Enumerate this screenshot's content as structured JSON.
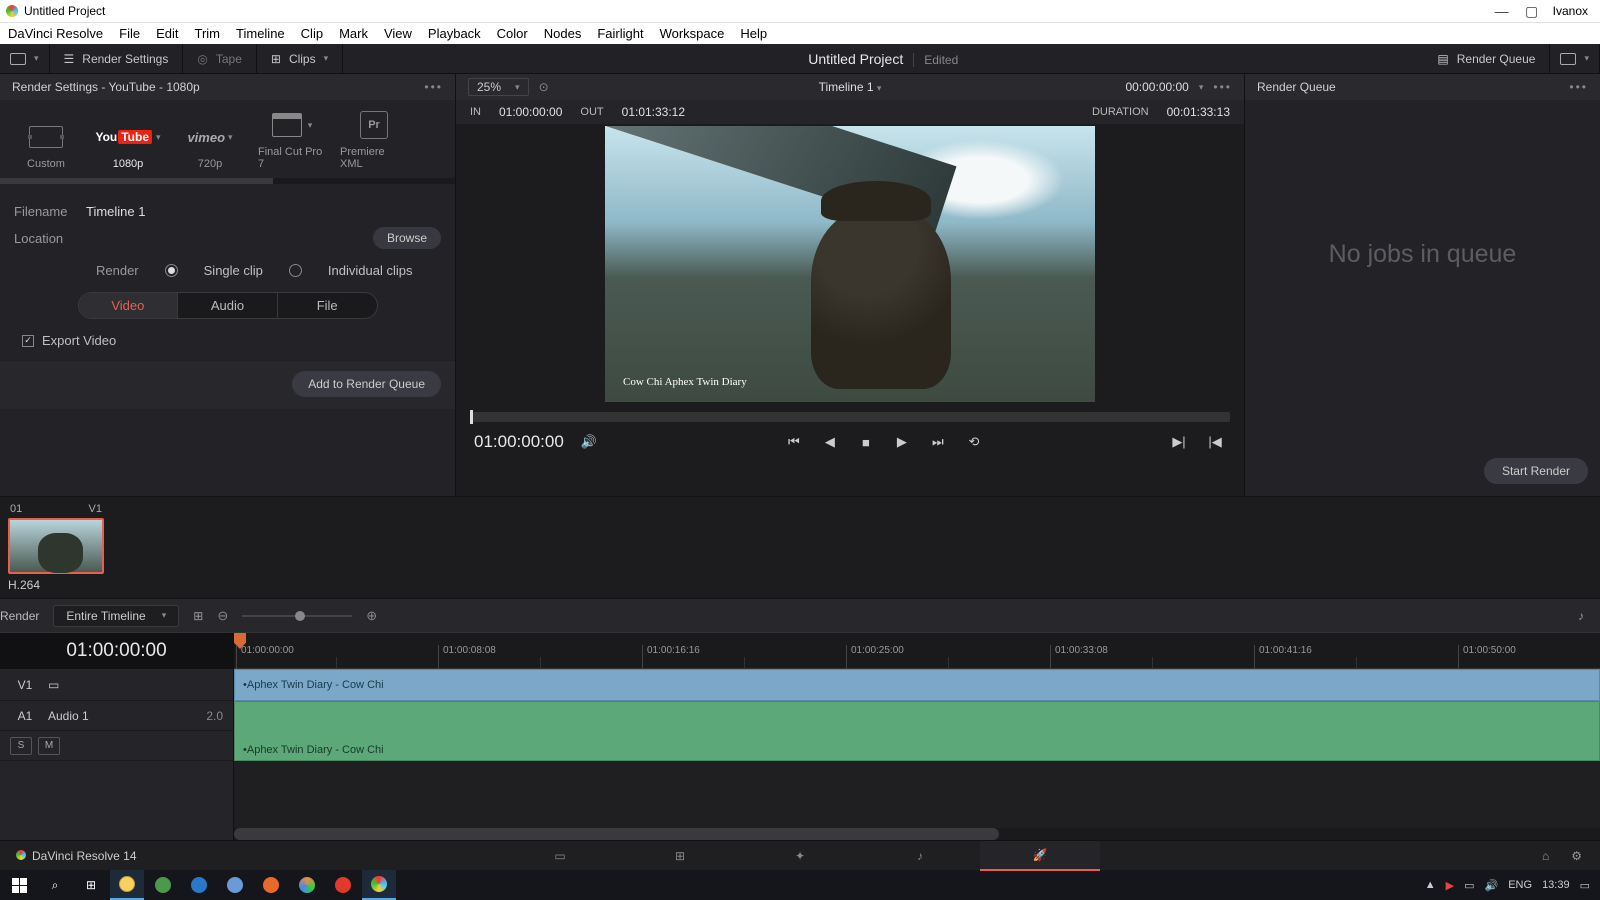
{
  "os_title": "Untitled Project",
  "os_user": "Ivanox",
  "menubar": [
    "DaVinci Resolve",
    "File",
    "Edit",
    "Trim",
    "Timeline",
    "Clip",
    "Mark",
    "View",
    "Playback",
    "Color",
    "Nodes",
    "Fairlight",
    "Workspace",
    "Help"
  ],
  "toolbar": {
    "render_settings": "Render Settings",
    "tape": "Tape",
    "clips": "Clips",
    "title": "Untitled Project",
    "edited": "Edited",
    "render_queue": "Render Queue"
  },
  "render": {
    "header": "Render Settings - YouTube - 1080p",
    "presets": [
      {
        "label": "Custom"
      },
      {
        "label": "1080p",
        "logo": "youtube",
        "selected": true
      },
      {
        "label": "720p",
        "logo": "vimeo"
      },
      {
        "label": "Final Cut Pro 7",
        "logo": "clap"
      },
      {
        "label": "Premiere XML",
        "logo": "pr"
      }
    ],
    "filename_lbl": "Filename",
    "filename": "Timeline 1",
    "location_lbl": "Location",
    "browse": "Browse",
    "render_lbl": "Render",
    "single": "Single clip",
    "individual": "Individual clips",
    "tabs": {
      "video": "Video",
      "audio": "Audio",
      "file": "File"
    },
    "export_video": "Export Video",
    "add_btn": "Add to Render Queue"
  },
  "viewer": {
    "zoom": "25%",
    "timeline_name": "Timeline 1",
    "tc_top": "00:00:00:00",
    "in_lbl": "IN",
    "in": "01:00:00:00",
    "out_lbl": "OUT",
    "out": "01:01:33:12",
    "dur_lbl": "DURATION",
    "dur": "00:01:33:13",
    "watermark": "Cow Chi\nAphex Twin Diary",
    "tc_big": "01:00:00:00"
  },
  "queue": {
    "header": "Render Queue",
    "empty": "No jobs in queue",
    "start": "Start Render"
  },
  "thumb": {
    "idx": "01",
    "track": "V1",
    "codec": "H.264"
  },
  "tl_toolbar": {
    "render": "Render",
    "scope": "Entire Timeline"
  },
  "timeline": {
    "tc": "01:00:00:00",
    "ruler": [
      "01:00:00:00",
      "01:00:08:08",
      "01:00:16:16",
      "01:00:25:00",
      "01:00:33:08",
      "01:00:41:16",
      "01:00:50:00"
    ],
    "v1": "V1",
    "a1": "A1",
    "a1_name": "Audio 1",
    "a1_ch": "2.0",
    "s": "S",
    "m": "M",
    "clip_name": "Aphex Twin Diary - Cow Chi"
  },
  "footer": {
    "app": "DaVinci Resolve 14"
  },
  "tray": {
    "lang": "ENG",
    "time": "13:39"
  }
}
